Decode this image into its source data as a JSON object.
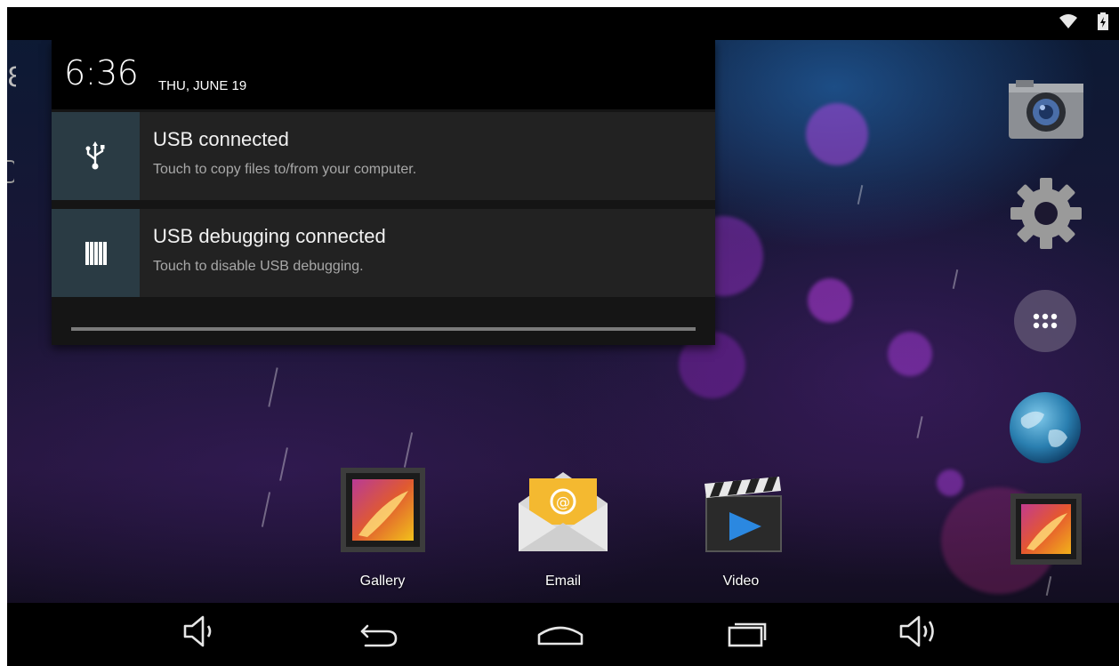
{
  "status_bar": {
    "icons": [
      "wifi-icon",
      "battery-charging-icon"
    ]
  },
  "notification_shade": {
    "time": "6:36",
    "date": "THU, JUNE 19",
    "notifications": [
      {
        "title": "USB connected",
        "text": "Touch to copy files to/from your computer.",
        "icon": "usb-icon"
      },
      {
        "title": "USB debugging connected",
        "text": "Touch to disable USB debugging.",
        "icon": "usb-debugging-icon"
      }
    ]
  },
  "right_dock": [
    "camera-icon",
    "settings-gear-icon",
    "all-apps-icon",
    "browser-globe-icon",
    "gallery-icon"
  ],
  "home_apps": [
    {
      "label": "Gallery",
      "icon": "gallery-icon"
    },
    {
      "label": "Email",
      "icon": "email-icon"
    },
    {
      "label": "Video",
      "icon": "video-icon"
    }
  ],
  "nav_bar": [
    "volume-down-icon",
    "back-icon",
    "home-icon",
    "recent-apps-icon",
    "volume-up-icon"
  ]
}
